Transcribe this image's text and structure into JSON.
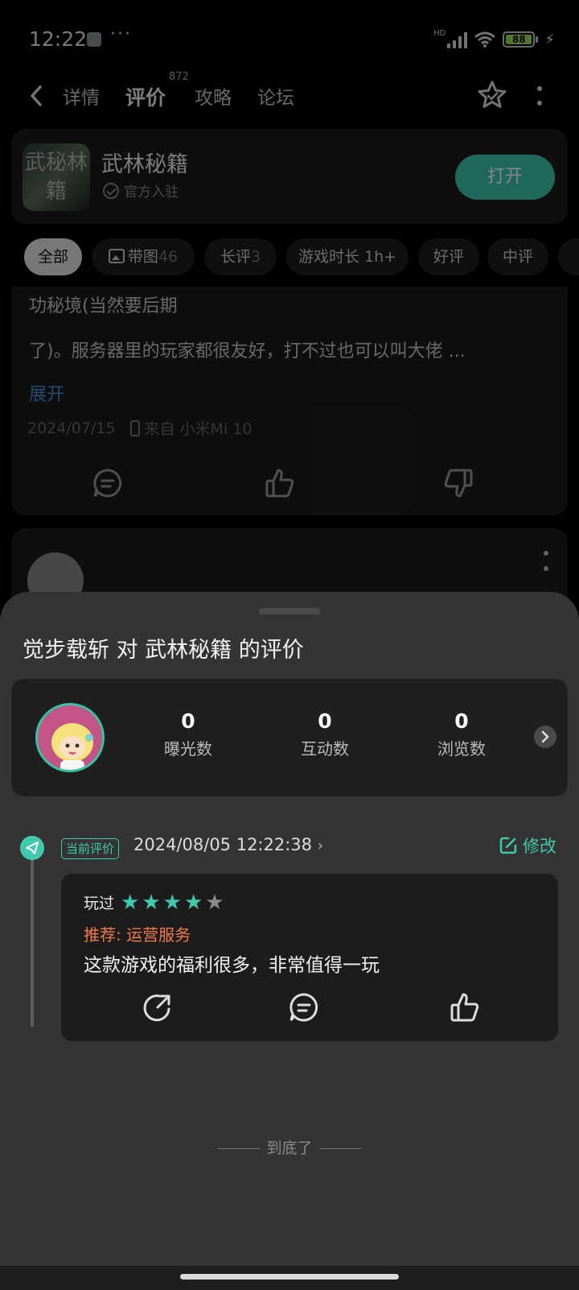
{
  "status_bar": {
    "time": "12:22",
    "more": "···",
    "battery": "88",
    "network": "HD"
  },
  "topnav": {
    "tabs": [
      {
        "label": "详情"
      },
      {
        "label": "评价",
        "badge": "872"
      },
      {
        "label": "攻略"
      },
      {
        "label": "论坛"
      }
    ]
  },
  "game": {
    "name": "武林秘籍",
    "icon_text": "武秘林籍",
    "official": "官方入驻",
    "open_label": "打开"
  },
  "filters": [
    {
      "label": "全部",
      "count": ""
    },
    {
      "label": "带图",
      "count": "46"
    },
    {
      "label": "长评",
      "count": "3"
    },
    {
      "label": "游戏时长 1h+",
      "count": ""
    },
    {
      "label": "好评",
      "count": ""
    },
    {
      "label": "中评",
      "count": ""
    }
  ],
  "review": {
    "line1": "功秘境(当然要后期",
    "line2": "了)。服务器里的玩家都很友好，打不过也可以叫大佬 ...",
    "expand": "展开",
    "date": "2024/07/15",
    "device": "来自 小米Mi 10"
  },
  "sheet": {
    "title": "觉步载斩 对 武林秘籍 的评价",
    "stats": [
      {
        "value": "0",
        "label": "曝光数"
      },
      {
        "value": "0",
        "label": "互动数"
      },
      {
        "value": "0",
        "label": "浏览数"
      }
    ],
    "current_badge": "当前评价",
    "datetime": "2024/08/05 12:22:38",
    "edit_label": "修改",
    "my_review": {
      "played": "玩过",
      "rating": 4,
      "rating_max": 5,
      "recommend": "推荐: 运营服务",
      "text": "这款游戏的福利很多，非常值得一玩"
    },
    "end_text": "到底了"
  },
  "colors": {
    "accent": "#40c9ac",
    "recommend": "#f07a4a",
    "link": "#4a8fd6",
    "star_off": "#8a8a8a"
  }
}
